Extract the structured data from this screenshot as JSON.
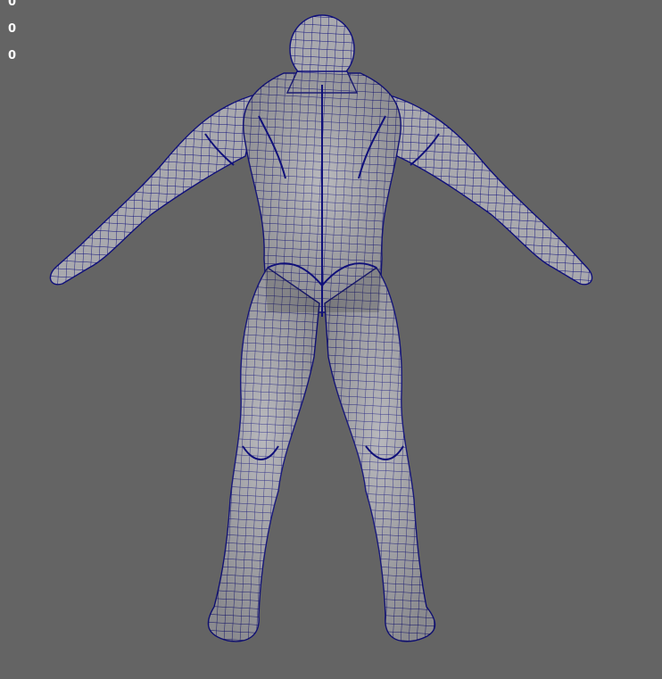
{
  "viewport": {
    "background_color": "#646464",
    "mesh_fill_color": "#a9a9ae",
    "wireframe_color": "#10107a",
    "hud_values": [
      "0",
      "0",
      "0"
    ]
  }
}
